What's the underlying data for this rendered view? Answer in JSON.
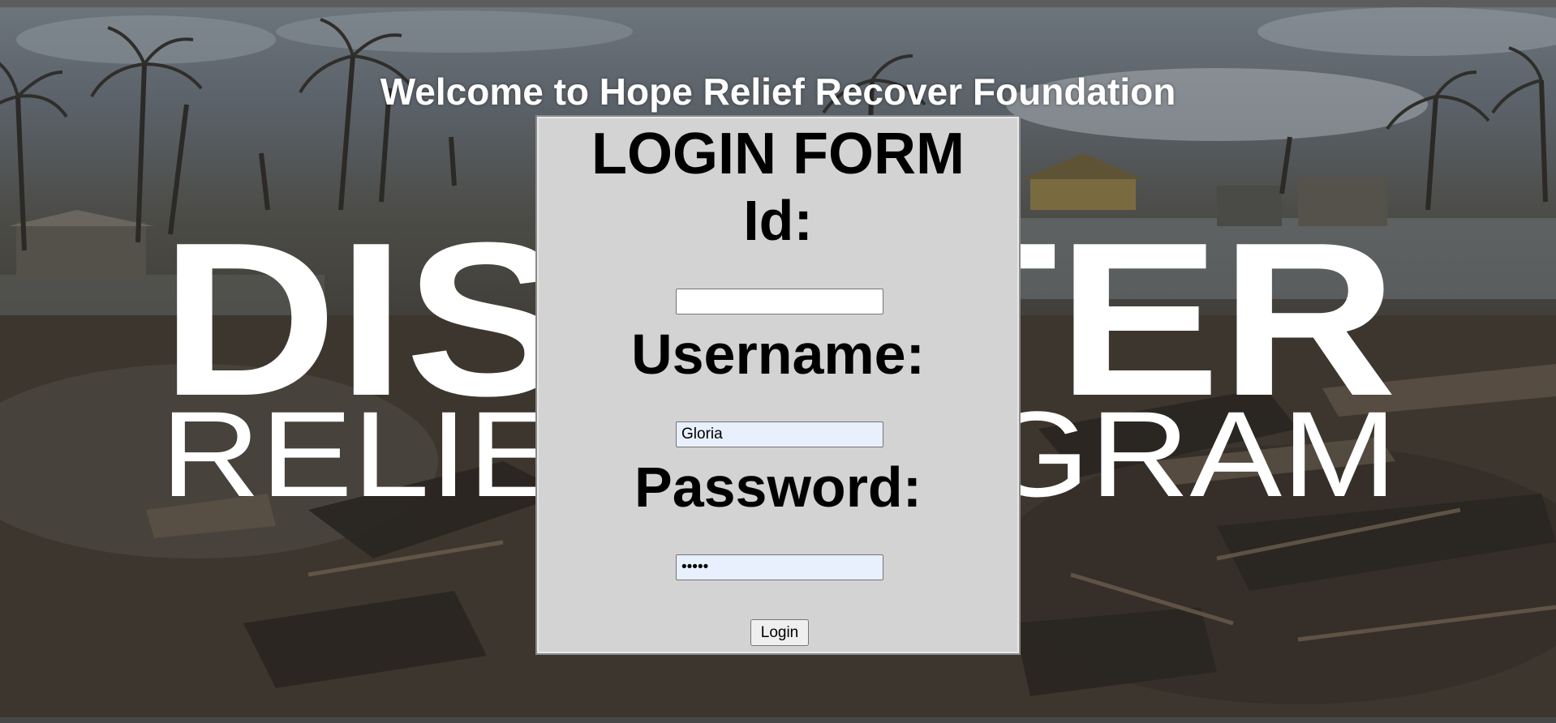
{
  "welcome_title": "Welcome to Hope Relief Recover Foundation",
  "background": {
    "headline_word_1": "DISASTER",
    "headline_word_2": "RELIEF PROGRAM"
  },
  "login_form": {
    "title": "LOGIN FORM",
    "id_label": "Id:",
    "id_value": "",
    "username_label": "Username:",
    "username_value": "Gloria",
    "password_label": "Password:",
    "password_value": "•••••",
    "login_button": "Login"
  },
  "colors": {
    "panel_background": "#d3d3d3",
    "autofill_background": "#e8f0fe",
    "title_color": "#ffffff"
  }
}
